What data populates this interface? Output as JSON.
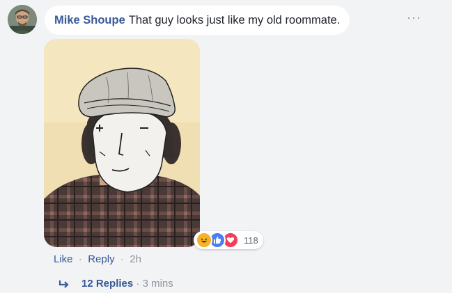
{
  "comment": {
    "author": "Mike Shoupe",
    "text": "That guy looks just like my old roommate."
  },
  "menu": {
    "more_label": "···"
  },
  "reactions": {
    "icons": [
      "haha-icon",
      "like-icon",
      "love-icon"
    ],
    "count": "118"
  },
  "actions": {
    "like": "Like",
    "separator": "·",
    "reply": "Reply",
    "time": "2h"
  },
  "replies": {
    "label": "12 Replies",
    "separator": "·",
    "time": "3 mins"
  },
  "colors": {
    "link": "#365899",
    "meta": "#90949c",
    "bubble": "#ffffff",
    "background": "#f2f3f5"
  }
}
